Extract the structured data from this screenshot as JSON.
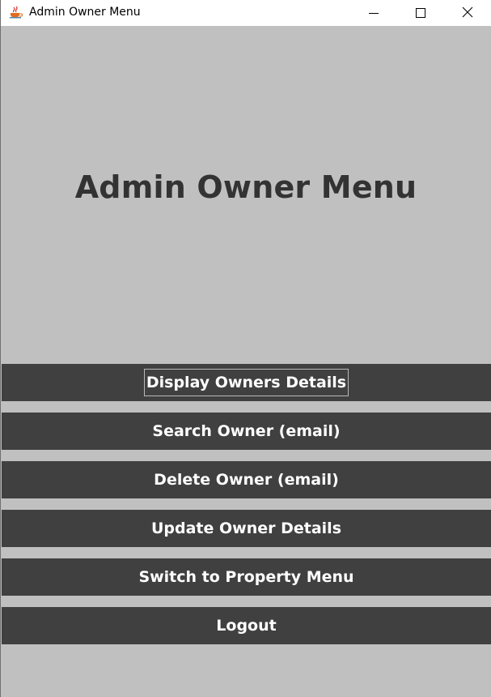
{
  "window": {
    "title": "Admin Owner Menu",
    "app_icon": "java-cup-icon",
    "controls": {
      "minimize_icon": "minimize-icon",
      "maximize_icon": "maximize-icon",
      "close_icon": "close-icon"
    }
  },
  "main": {
    "heading": "Admin Owner Menu"
  },
  "menu": {
    "buttons": [
      {
        "label": "Display Owners Details",
        "focused": true
      },
      {
        "label": "Search Owner (email)",
        "focused": false
      },
      {
        "label": "Delete Owner (email)",
        "focused": false
      },
      {
        "label": "Update Owner Details",
        "focused": false
      },
      {
        "label": "Switch to Property Menu",
        "focused": false
      },
      {
        "label": "Logout",
        "focused": false
      }
    ]
  },
  "colors": {
    "background": "#c0c0c0",
    "button_bg": "#404040",
    "button_text": "#ffffff",
    "heading_text": "#333333",
    "titlebar_bg": "#ffffff"
  }
}
